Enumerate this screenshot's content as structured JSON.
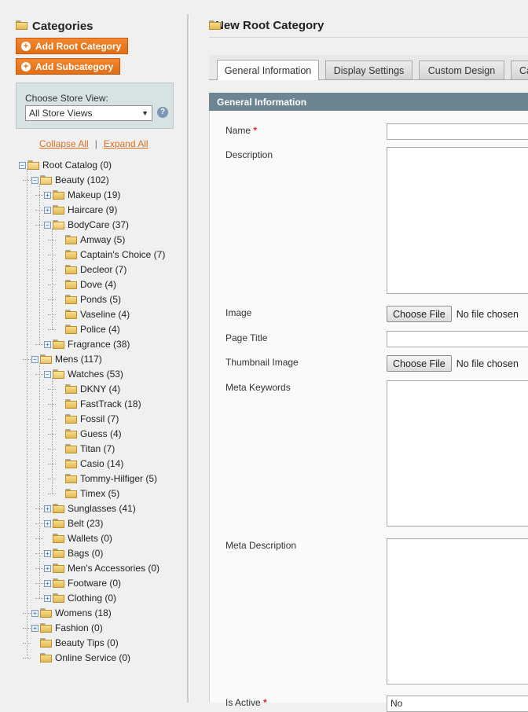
{
  "sidebar": {
    "title": "Categories",
    "add_root_label": "Add Root Category",
    "add_sub_label": "Add Subcategory",
    "store_view_label": "Choose Store View:",
    "store_view_value": "All Store Views",
    "collapse_all": "Collapse All",
    "expand_all": "Expand All",
    "tree": [
      {
        "label": "Root Catalog (0)",
        "depth": 0,
        "toggle": "minus"
      },
      {
        "label": "Beauty (102)",
        "depth": 1,
        "toggle": "minus"
      },
      {
        "label": "Makeup (19)",
        "depth": 2,
        "toggle": "plus"
      },
      {
        "label": "Haircare (9)",
        "depth": 2,
        "toggle": "plus"
      },
      {
        "label": "BodyCare (37)",
        "depth": 2,
        "toggle": "minus"
      },
      {
        "label": "Amway (5)",
        "depth": 3,
        "toggle": "none"
      },
      {
        "label": "Captain's Choice (7)",
        "depth": 3,
        "toggle": "none"
      },
      {
        "label": "Decleor (7)",
        "depth": 3,
        "toggle": "none"
      },
      {
        "label": "Dove (4)",
        "depth": 3,
        "toggle": "none"
      },
      {
        "label": "Ponds (5)",
        "depth": 3,
        "toggle": "none"
      },
      {
        "label": "Vaseline (4)",
        "depth": 3,
        "toggle": "none"
      },
      {
        "label": "Police (4)",
        "depth": 3,
        "toggle": "none"
      },
      {
        "label": "Fragrance (38)",
        "depth": 2,
        "toggle": "plus"
      },
      {
        "label": "Mens (117)",
        "depth": 1,
        "toggle": "minus"
      },
      {
        "label": "Watches (53)",
        "depth": 2,
        "toggle": "minus"
      },
      {
        "label": "DKNY (4)",
        "depth": 3,
        "toggle": "none"
      },
      {
        "label": "FastTrack (18)",
        "depth": 3,
        "toggle": "none"
      },
      {
        "label": "Fossil (7)",
        "depth": 3,
        "toggle": "none"
      },
      {
        "label": "Guess (4)",
        "depth": 3,
        "toggle": "none"
      },
      {
        "label": "Titan (7)",
        "depth": 3,
        "toggle": "none"
      },
      {
        "label": "Casio (14)",
        "depth": 3,
        "toggle": "none"
      },
      {
        "label": "Tommy-Hilfiger (5)",
        "depth": 3,
        "toggle": "none"
      },
      {
        "label": "Timex (5)",
        "depth": 3,
        "toggle": "none"
      },
      {
        "label": "Sunglasses (41)",
        "depth": 2,
        "toggle": "plus"
      },
      {
        "label": "Belt (23)",
        "depth": 2,
        "toggle": "plus"
      },
      {
        "label": "Wallets (0)",
        "depth": 2,
        "toggle": "none"
      },
      {
        "label": "Bags (0)",
        "depth": 2,
        "toggle": "plus"
      },
      {
        "label": "Men's Accessories (0)",
        "depth": 2,
        "toggle": "plus"
      },
      {
        "label": "Footware (0)",
        "depth": 2,
        "toggle": "plus"
      },
      {
        "label": "Clothing (0)",
        "depth": 2,
        "toggle": "plus"
      },
      {
        "label": "Womens (18)",
        "depth": 1,
        "toggle": "plus"
      },
      {
        "label": "Fashion (0)",
        "depth": 1,
        "toggle": "plus"
      },
      {
        "label": "Beauty Tips (0)",
        "depth": 1,
        "toggle": "none"
      },
      {
        "label": "Online Service (0)",
        "depth": 1,
        "toggle": "none"
      }
    ]
  },
  "main": {
    "title": "New Root Category",
    "tabs": [
      {
        "label": "General Information",
        "active": true
      },
      {
        "label": "Display Settings",
        "active": false
      },
      {
        "label": "Custom Design",
        "active": false
      },
      {
        "label": "Ca",
        "active": false
      }
    ],
    "section_title": "General Information",
    "fields": {
      "name_label": "Name",
      "required_mark": "*",
      "description_label": "Description",
      "image_label": "Image",
      "page_title_label": "Page Title",
      "thumbnail_label": "Thumbnail Image",
      "meta_keywords_label": "Meta Keywords",
      "meta_description_label": "Meta Description",
      "is_active_label": "Is Active",
      "is_active_value": "No",
      "choose_file_label": "Choose File",
      "no_file_text": "No file chosen"
    }
  },
  "colors": {
    "accent_orange": "#e47114",
    "section_header": "#6d8591",
    "link_orange": "#d96e1f"
  }
}
